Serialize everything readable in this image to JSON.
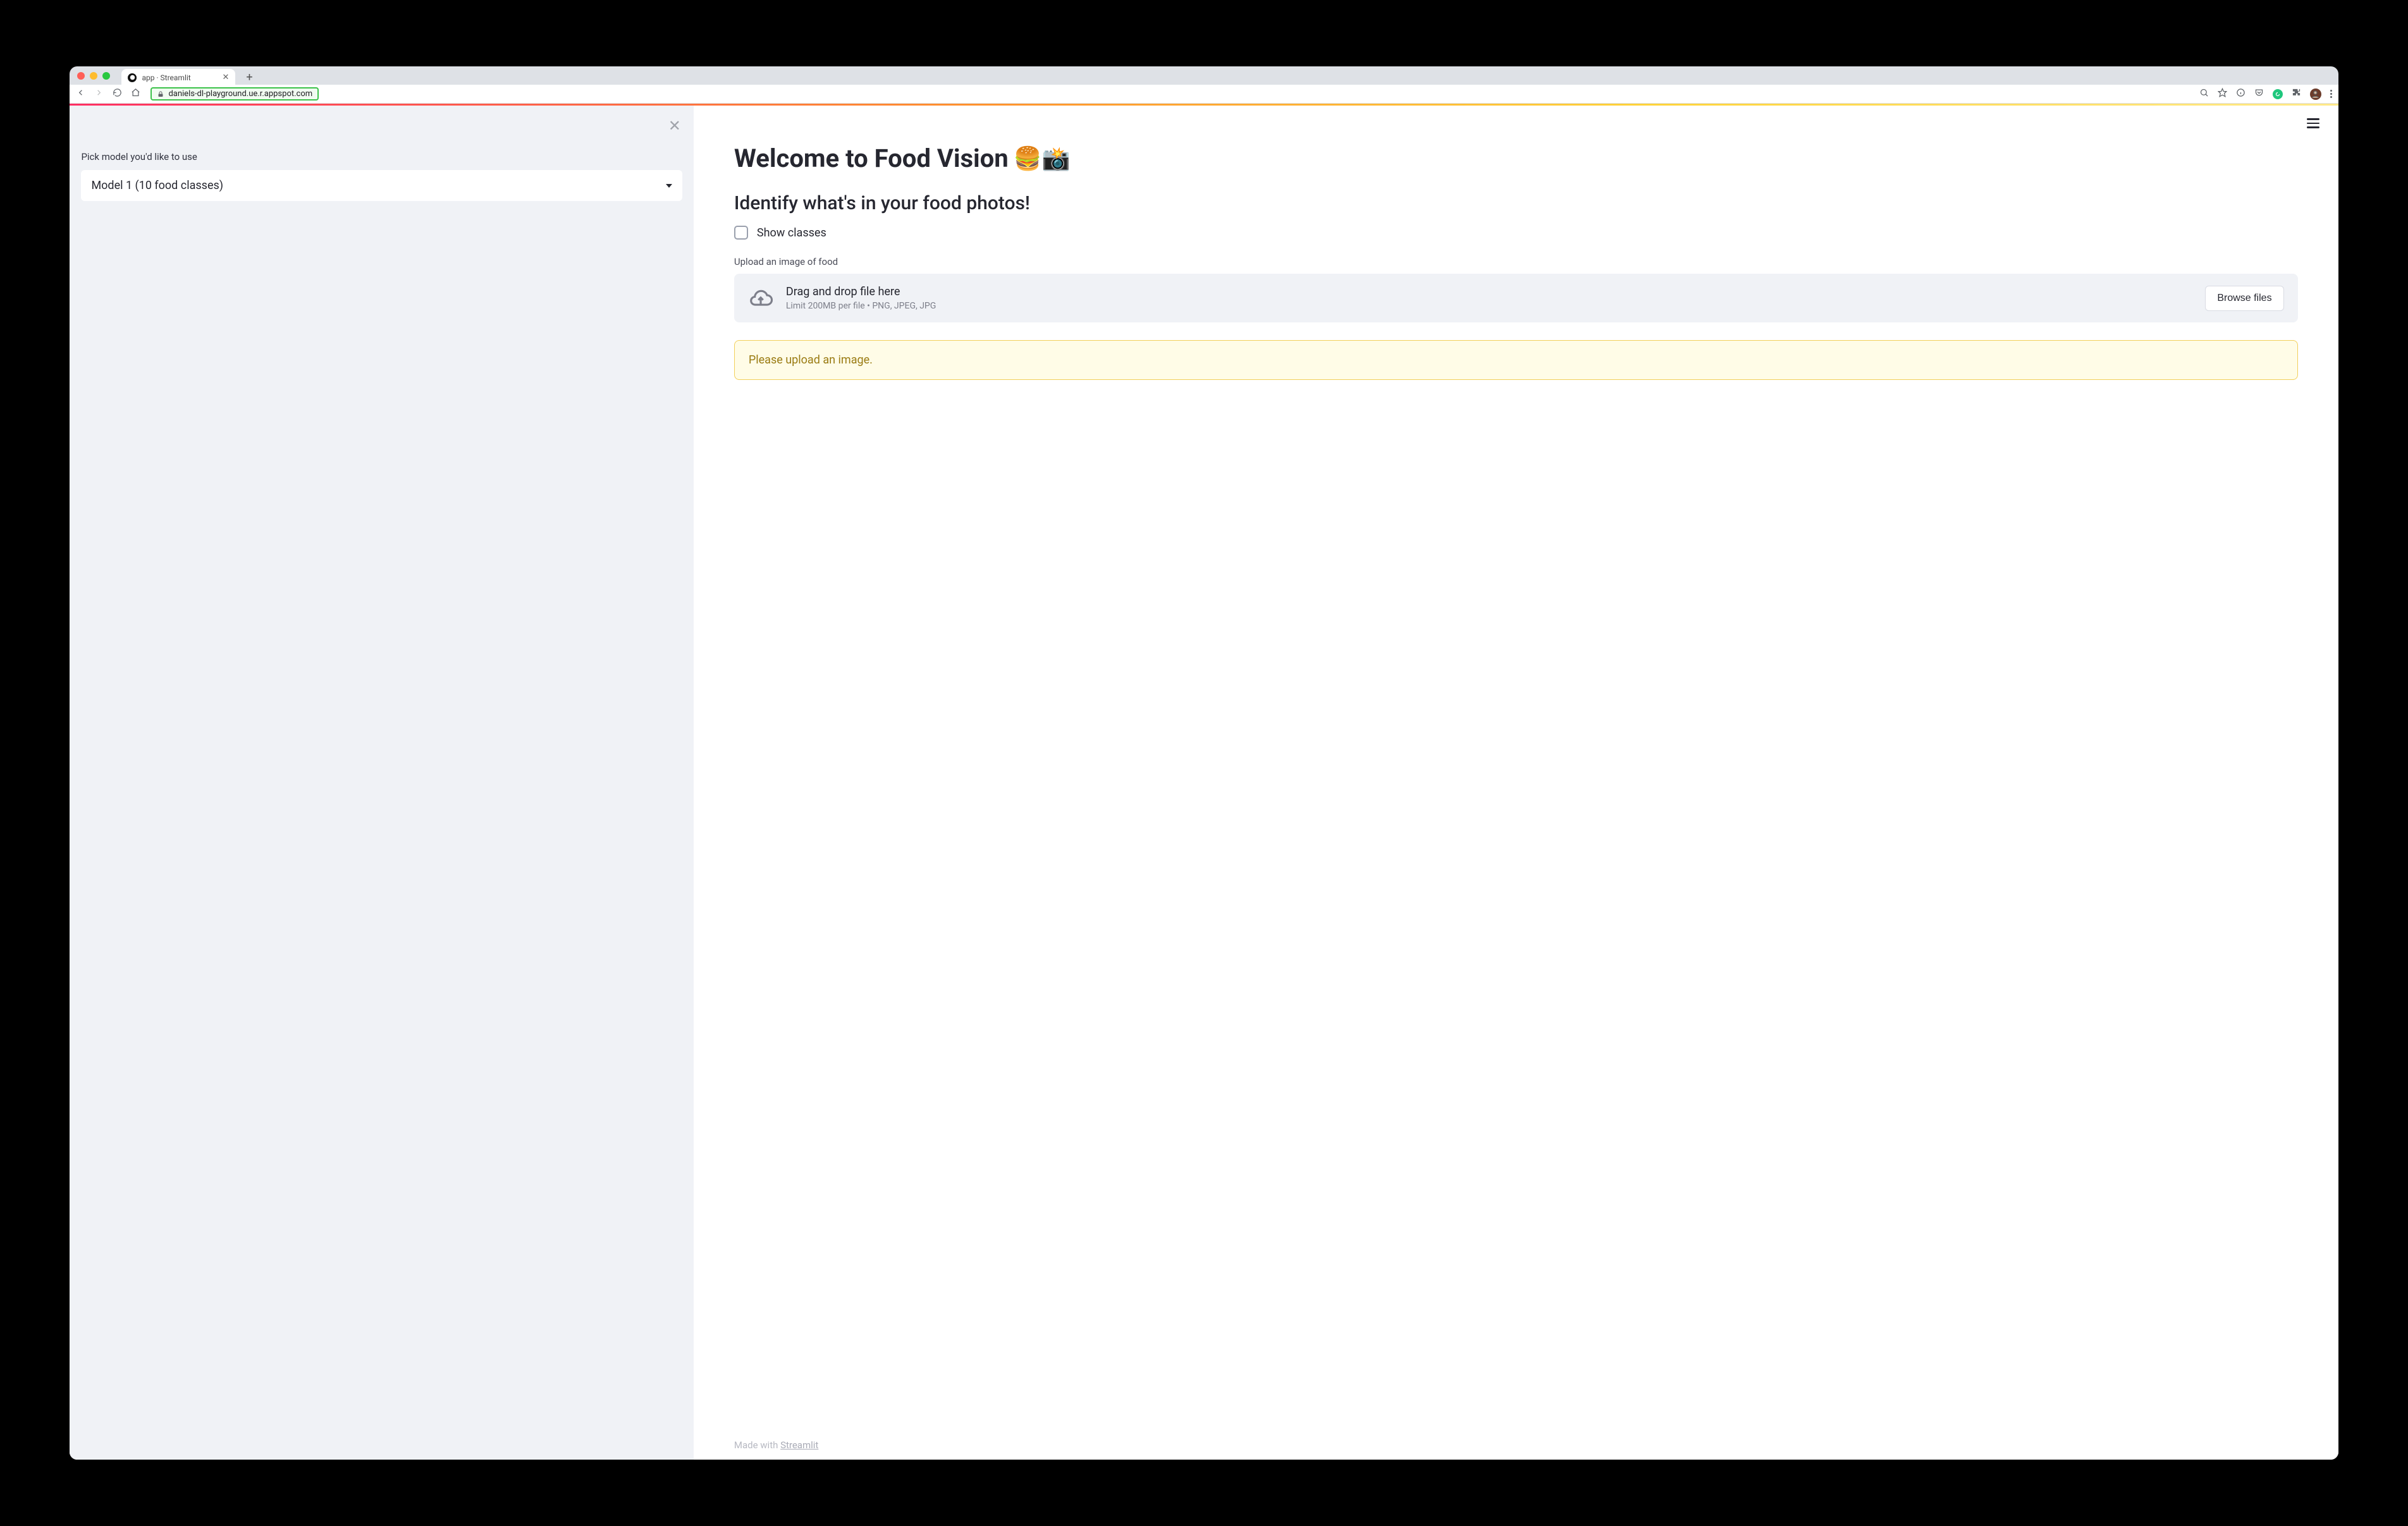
{
  "browser": {
    "tab_title": "app · Streamlit",
    "url": "daniels-dl-playground.ue.r.appspot.com"
  },
  "sidebar": {
    "label": "Pick model you'd like to use",
    "selected_model": "Model 1 (10 food classes)"
  },
  "main": {
    "title_text": "Welcome to Food Vision ",
    "title_emojis": "🍔📸",
    "subtitle": "Identify what's in your food photos!",
    "checkbox_label": "Show classes",
    "upload_label": "Upload an image of food",
    "dropzone": {
      "heading": "Drag and drop file here",
      "subtext": "Limit 200MB per file • PNG, JPEG, JPG",
      "browse_label": "Browse files"
    },
    "warning": "Please upload an image."
  },
  "footer": {
    "made_with": "Made with ",
    "link_text": "Streamlit"
  }
}
